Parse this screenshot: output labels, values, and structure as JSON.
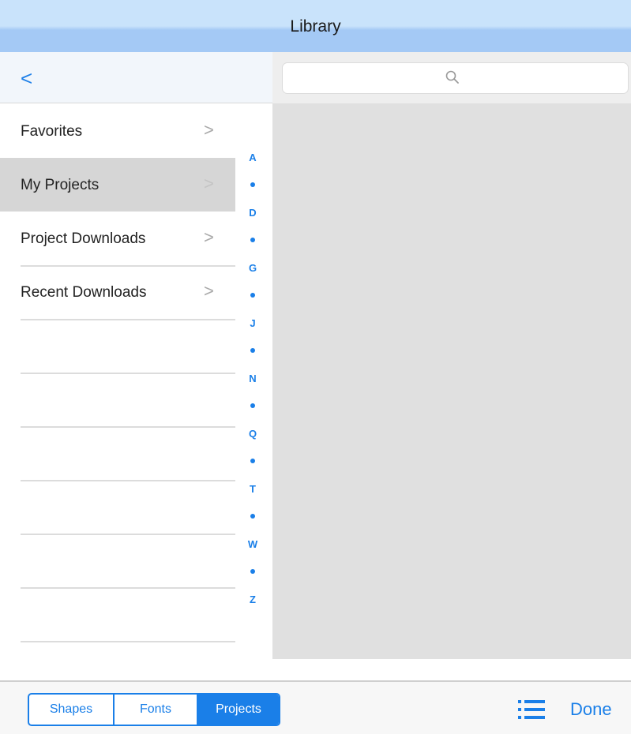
{
  "header": {
    "title": "Library"
  },
  "nav": {
    "back_label": "<"
  },
  "search": {
    "icon": "search-icon"
  },
  "sidebar": {
    "items": [
      {
        "label": "Favorites",
        "chevron": ">",
        "selected": false
      },
      {
        "label": "My Projects",
        "chevron": ">",
        "selected": true
      },
      {
        "label": "Project Downloads",
        "chevron": ">",
        "selected": false
      },
      {
        "label": "Recent Downloads",
        "chevron": ">",
        "selected": false
      }
    ]
  },
  "index": {
    "letters": [
      "A",
      "D",
      "G",
      "J",
      "N",
      "Q",
      "T",
      "W",
      "Z"
    ]
  },
  "footer": {
    "segments": [
      {
        "label": "Shapes",
        "active": false
      },
      {
        "label": "Fonts",
        "active": false
      },
      {
        "label": "Projects",
        "active": true
      }
    ],
    "list_icon": "list-icon",
    "done_label": "Done"
  },
  "colors": {
    "accent": "#1a7fe8",
    "title_bar": "#a4c9f5",
    "content_bg": "#e0e0e0",
    "selected_row": "#d6d6d6"
  }
}
